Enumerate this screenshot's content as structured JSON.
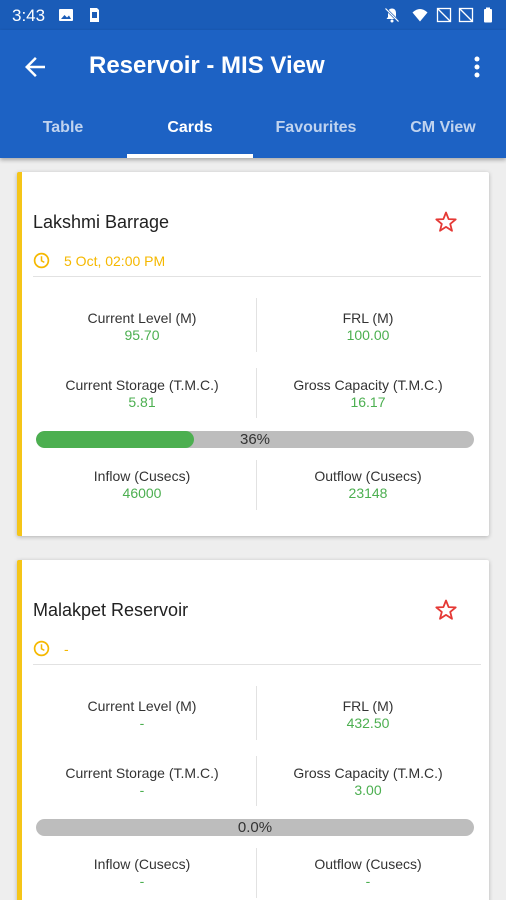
{
  "status_bar": {
    "time": "3:43",
    "left_icons": [
      "image-icon",
      "sd-card-icon"
    ],
    "right_icons": [
      "notifications-off-icon",
      "wifi-icon",
      "no-signal-icon",
      "no-signal-icon",
      "battery-icon"
    ]
  },
  "app_bar": {
    "title": "Reservoir - MIS View",
    "tabs": [
      {
        "label": "Table",
        "active": false
      },
      {
        "label": "Cards",
        "active": true
      },
      {
        "label": "Favourites",
        "active": false
      },
      {
        "label": "CM View",
        "active": false
      }
    ]
  },
  "colors": {
    "app_bar": "#1d62c4",
    "status_bar": "#1a5cb8",
    "card_accent": "#f5c518",
    "value_green": "#4caf50",
    "star_red": "#e53935",
    "time_amber": "#f5b800"
  },
  "cards": [
    {
      "name": "Lakshmi Barrage",
      "time": "5 Oct, 02:00 PM",
      "current_level_label": "Current Level (M)",
      "current_level": "95.70",
      "frl_label": "FRL (M)",
      "frl": "100.00",
      "current_storage_label": "Current Storage (T.M.C.)",
      "current_storage": "5.81",
      "gross_capacity_label": "Gross Capacity (T.M.C.)",
      "gross_capacity": "16.17",
      "progress_label": "36%",
      "progress_fraction": 0.36,
      "inflow_label": "Inflow (Cusecs)",
      "inflow": "46000",
      "outflow_label": "Outflow (Cusecs)",
      "outflow": "23148"
    },
    {
      "name": "Malakpet Reservoir",
      "time": "-",
      "current_level_label": "Current Level (M)",
      "current_level": "-",
      "frl_label": "FRL (M)",
      "frl": "432.50",
      "current_storage_label": "Current Storage (T.M.C.)",
      "current_storage": "-",
      "gross_capacity_label": "Gross Capacity (T.M.C.)",
      "gross_capacity": "3.00",
      "progress_label": "0.0%",
      "progress_fraction": 0.0,
      "inflow_label": "Inflow (Cusecs)",
      "inflow": "-",
      "outflow_label": "Outflow (Cusecs)",
      "outflow": "-"
    }
  ]
}
